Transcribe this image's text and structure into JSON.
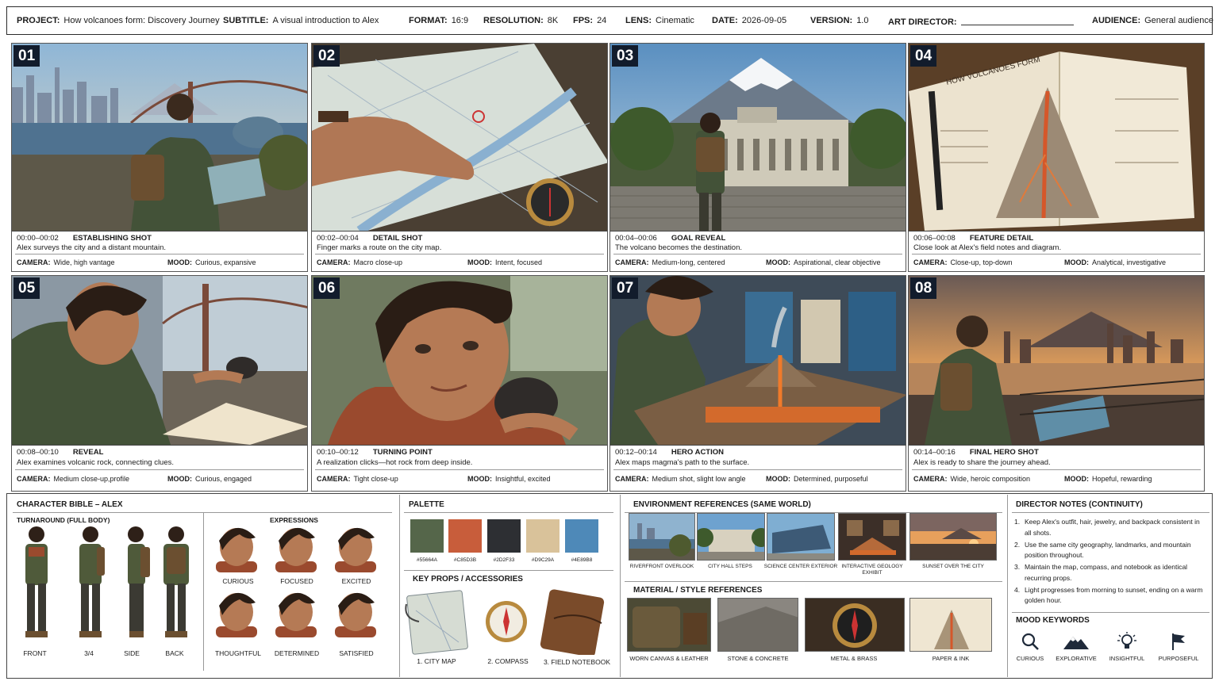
{
  "header": {
    "project_label": "PROJECT:",
    "project": "How volcanoes form: Discovery Journey",
    "subtitle_label": "SUBTITLE:",
    "subtitle": "A visual introduction to Alex",
    "format_label": "FORMAT:",
    "format": "16:9",
    "resolution_label": "RESOLUTION:",
    "resolution": "8K",
    "fps_label": "FPS:",
    "fps": "24",
    "lens_label": "LENS:",
    "lens": "Cinematic",
    "date_label": "DATE:",
    "date": "2026-09-05",
    "version_label": "VERSION:",
    "version": "1.0",
    "art_director_label": "ART DIRECTOR:",
    "audience_label": "AUDIENCE:",
    "audience": "General audience"
  },
  "camera_label": "CAMERA:",
  "mood_label": "MOOD:",
  "panels": [
    {
      "num": "01",
      "time": "00:00–00:02",
      "shot": "ESTABLISHING SHOT",
      "desc": "Alex surveys the city and a distant mountain.",
      "camera": "Wide, high vantage",
      "mood": "Curious, expansive"
    },
    {
      "num": "02",
      "time": "00:02–00:04",
      "shot": "DETAIL SHOT",
      "desc": "Finger marks a route on the city map.",
      "camera": "Macro close-up",
      "mood": "Intent, focused"
    },
    {
      "num": "03",
      "time": "00:04–00:06",
      "shot": "GOAL REVEAL",
      "desc": "The volcano becomes the destination.",
      "camera": "Medium-long, centered",
      "mood": "Aspirational, clear objective"
    },
    {
      "num": "04",
      "time": "00:06–00:08",
      "shot": "FEATURE DETAIL",
      "desc": "Close look at Alex's field notes and diagram.",
      "camera": "Close-up, top-down",
      "mood": "Analytical, investigative"
    },
    {
      "num": "05",
      "time": "00:08–00:10",
      "shot": "REVEAL",
      "desc": "Alex examines volcanic rock, connecting clues.",
      "camera": "Medium close-up,profile",
      "mood": "Curious, engaged"
    },
    {
      "num": "06",
      "time": "00:10–00:12",
      "shot": "TURNING POINT",
      "desc": "A realization clicks—hot rock from deep inside.",
      "camera": "Tight close-up",
      "mood": "Insightful, excited"
    },
    {
      "num": "07",
      "time": "00:12–00:14",
      "shot": "HERO ACTION",
      "desc": "Alex maps magma's path to the surface.",
      "camera": "Medium shot, slight low angle",
      "mood": "Determined, purposeful"
    },
    {
      "num": "08",
      "time": "00:14–00:16",
      "shot": "FINAL HERO SHOT",
      "desc": "Alex is ready to share the journey ahead.",
      "camera": "Wide, heroic composition",
      "mood": "Hopeful, rewarding"
    }
  ],
  "panel4_notebook_title": "HOW VOLCANOES FORM",
  "character": {
    "title": "CHARACTER BIBLE – ALEX",
    "turnaround_title": "TURNAROUND (FULL BODY)",
    "turnaround": [
      "FRONT",
      "3/4",
      "SIDE",
      "BACK"
    ],
    "expressions_title": "EXPRESSIONS",
    "expressions": [
      "CURIOUS",
      "FOCUSED",
      "EXCITED",
      "THOUGHTFUL",
      "DETERMINED",
      "SATISFIED"
    ]
  },
  "palette": {
    "title": "PALETTE",
    "colors": [
      "#55664A",
      "#C85D3B",
      "#2D2F33",
      "#D9C29A",
      "#4E89B8"
    ]
  },
  "props": {
    "title": "KEY PROPS / ACCESSORIES",
    "items": [
      "1. CITY MAP",
      "2. COMPASS",
      "3. FIELD NOTEBOOK"
    ]
  },
  "environment": {
    "title": "ENVIRONMENT REFERENCES (SAME WORLD)",
    "items": [
      "RIVERFRONT OVERLOOK",
      "CITY HALL STEPS",
      "SCIENCE CENTER EXTERIOR",
      "INTERACTIVE GEOLOGY EXHIBIT",
      "SUNSET OVER THE CITY"
    ]
  },
  "materials": {
    "title": "MATERIAL / STYLE REFERENCES",
    "items": [
      "WORN CANVAS & LEATHER",
      "STONE & CONCRETE",
      "METAL & BRASS",
      "PAPER & INK"
    ]
  },
  "director_notes": {
    "title": "DIRECTOR NOTES (CONTINUITY)",
    "items": [
      "Keep Alex's outfit, hair, jewelry, and backpack consistent in all shots.",
      "Use the same city geography, landmarks, and mountain position throughout.",
      "Maintain the map, compass, and notebook as identical recurring props.",
      "Light progresses from morning to sunset, ending on a warm golden hour."
    ]
  },
  "mood_keywords": {
    "title": "MOOD KEYWORDS",
    "items": [
      {
        "label": "CURIOUS",
        "icon": "magnifier-icon"
      },
      {
        "label": "EXPLORATIVE",
        "icon": "mountain-icon"
      },
      {
        "label": "INSIGHTFUL",
        "icon": "lightbulb-icon"
      },
      {
        "label": "PURPOSEFUL",
        "icon": "flag-icon"
      }
    ]
  }
}
